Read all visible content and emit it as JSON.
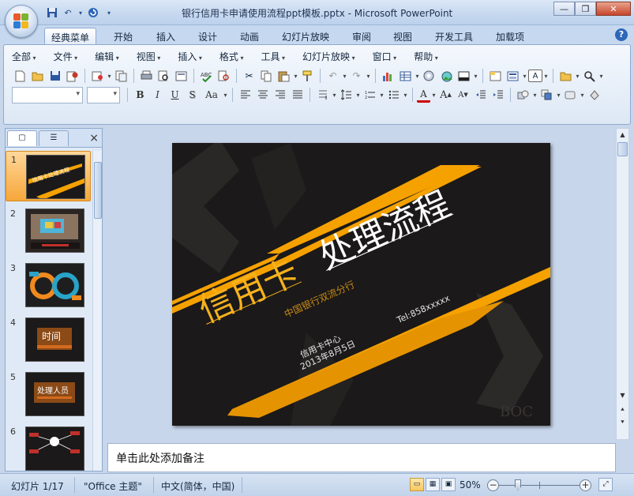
{
  "window": {
    "title": "银行信用卡申请使用流程ppt模板.pptx - Microsoft PowerPoint",
    "controls": [
      "minimize-icon",
      "maximize-icon",
      "close-icon"
    ]
  },
  "quick_access": [
    "save-icon",
    "undo-icon",
    "redo-icon",
    "customize-icon"
  ],
  "ribbon_tabs": [
    "经典菜单",
    "开始",
    "插入",
    "设计",
    "动画",
    "幻灯片放映",
    "审阅",
    "视图",
    "开发工具",
    "加载项"
  ],
  "active_tab": "经典菜单",
  "classic_menu": [
    "全部",
    "文件",
    "编辑",
    "视图",
    "插入",
    "格式",
    "工具",
    "幻灯片放映",
    "窗口",
    "帮助"
  ],
  "format_buttons": {
    "bold": "B",
    "italic": "I",
    "underline": "U",
    "shadow": "S",
    "change_case": "Aa"
  },
  "left_pane": {
    "tabs": [
      "slides-tab-icon",
      "outline-tab-icon"
    ],
    "close": "×",
    "thumbnails": [
      {
        "num": "1",
        "label": "信用卡处理流程"
      },
      {
        "num": "2",
        "label": ""
      },
      {
        "num": "3",
        "label": ""
      },
      {
        "num": "4",
        "label": "时间"
      },
      {
        "num": "5",
        "label": "处理人员"
      },
      {
        "num": "6",
        "label": ""
      }
    ]
  },
  "slide": {
    "title_part1": "信用卡",
    "title_part2": "处理流程",
    "subtitle": "中国银行双流分行",
    "tel": "Tel:858xxxxx",
    "org": "信用卡中心",
    "date": "2013年8月5日",
    "watermark": "BOC",
    "accent_color": "#f5a100"
  },
  "notes": {
    "placeholder": "单击此处添加备注"
  },
  "status_bar": {
    "slide_indicator": "幻灯片 1/17",
    "theme": "\"Office 主题\"",
    "language": "中文(简体，中国)",
    "zoom": "50%",
    "zoom_percent": 50
  }
}
